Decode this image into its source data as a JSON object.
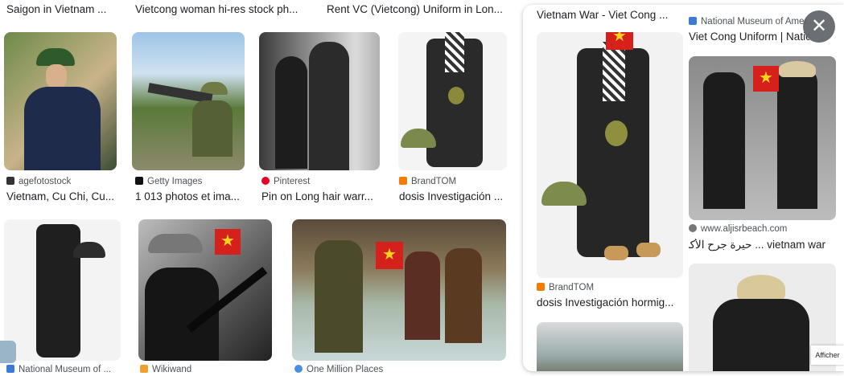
{
  "row1_titles": {
    "a": "Saigon in Vietnam ...",
    "b": "Vietcong woman hi-res stock ph...",
    "c": "Rent VC (Vietcong) Uniform in Lon..."
  },
  "results": {
    "r1": {
      "source": "agefotostock",
      "title": "Vietnam, Cu Chi, Cu..."
    },
    "r2": {
      "source": "Getty Images",
      "title": "1 013 photos et ima..."
    },
    "r3": {
      "source": "Pinterest",
      "title": "Pin on Long hair warr..."
    },
    "r4": {
      "source": "BrandTOM",
      "title": "dosis Investigación ..."
    },
    "r5": {
      "source": "National Museum of ..."
    },
    "r6": {
      "source": "Wikiwand"
    },
    "r7": {
      "source": "One Million Places"
    }
  },
  "panel": {
    "left_title": "Vietnam War - Viet Cong ...",
    "right_source": "National Museum of Amer...",
    "right_title": "Viet Cong Uniform | Nation...",
    "bottom_left_source": "BrandTOM",
    "bottom_left_title": "dosis Investigación hormig...",
    "bottom_right_source": "www.aljisrbeach.com",
    "bottom_right_title": "vietnam war ... حيرة جرح الأكبر"
  },
  "controls": {
    "close_symbol": "✕",
    "afficher_label": "Afficher"
  },
  "colors": {
    "flag_red": "#d6201c",
    "flag_star": "#ffd21f",
    "pinterest": "#e60023",
    "brandtom": "#f57c00",
    "close_bg": "#5f6368"
  }
}
